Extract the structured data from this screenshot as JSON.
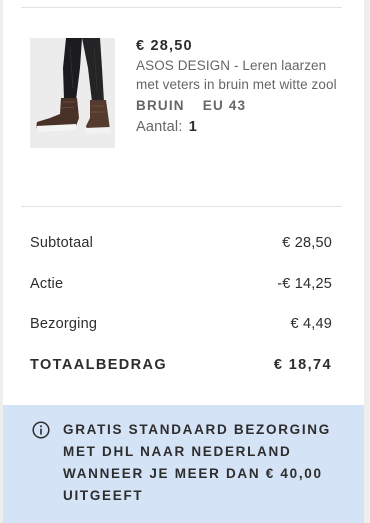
{
  "product": {
    "price": "€ 28,50",
    "title": "ASOS DESIGN - Leren laarzen met veters in bruin met witte zool",
    "color": "BRUIN",
    "size": "EU 43",
    "quantity_label": "Aantal:",
    "quantity_value": "1",
    "image_icon": "boots-product-photo"
  },
  "totals": {
    "subtotal_label": "Subtotaal",
    "subtotal_value": "€ 28,50",
    "discount_label": "Actie",
    "discount_value": "-€ 14,25",
    "shipping_label": "Bezorging",
    "shipping_value": "€ 4,49",
    "total_label": "TOTAALBEDRAG",
    "total_value": "€ 18,74"
  },
  "banner": {
    "icon": "info-icon",
    "text": "GRATIS STANDAARD BEZORGING MET DHL NAAR NEDERLAND WANNEER JE MEER DAN € 40,00 UITGEEFT",
    "background": "#d5e3f6"
  }
}
